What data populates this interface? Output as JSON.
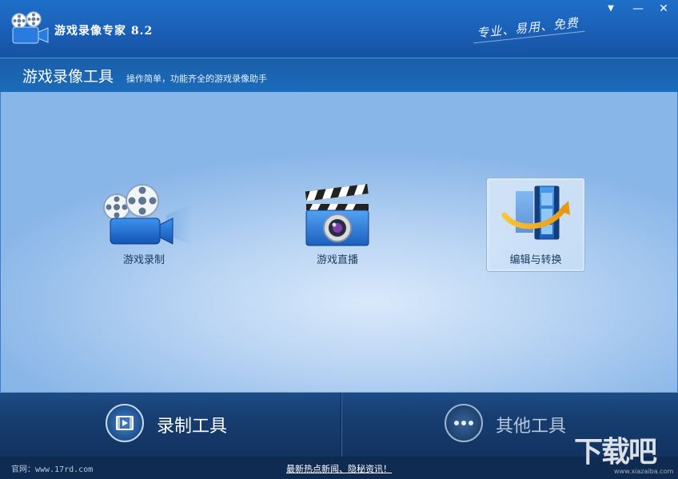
{
  "window": {
    "title": "游戏录像专家 8.2",
    "slogan": "专业、易用、免费",
    "min_glyph": "—",
    "close_glyph": "✕",
    "menu_glyph": "▼"
  },
  "subheader": {
    "title": "游戏录像工具",
    "description": "操作简单，功能齐全的游戏录像助手"
  },
  "tools": [
    {
      "label": "游戏录制",
      "icon": "camera-reel-icon",
      "selected": false
    },
    {
      "label": "游戏直播",
      "icon": "clapperboard-icon",
      "selected": false
    },
    {
      "label": "编辑与转换",
      "icon": "film-convert-icon",
      "selected": true
    }
  ],
  "bottom": {
    "record_tools_label": "录制工具",
    "other_tools_label": "其他工具"
  },
  "footer": {
    "website": "官网：www.17rd.com",
    "news_link": "最新热点新闻、隐秘资讯！"
  },
  "watermark": {
    "text": "下载吧",
    "url": "www.xiazaiba.com"
  },
  "colors": {
    "titlebar": "#1a5fb6",
    "bottom_bar": "#163d70",
    "accent": "#2f7fe0"
  }
}
